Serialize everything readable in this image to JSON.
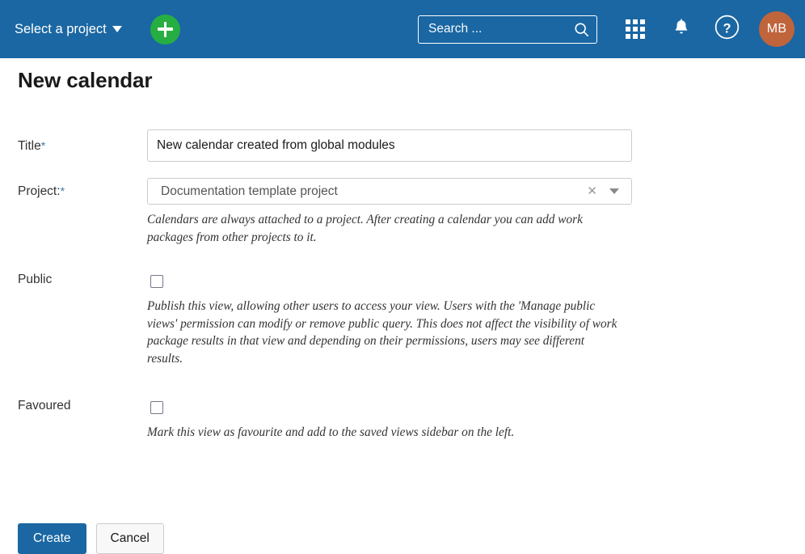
{
  "header": {
    "project_selector_label": "Select a project",
    "add_button_icon": "plus-icon",
    "search": {
      "placeholder": "Search ...",
      "value": "",
      "icon": "search-icon"
    },
    "modules_icon": "grid-icon",
    "notifications_icon": "bell-icon",
    "help_icon": "question-mark-circle-icon",
    "avatar_initials": "MB",
    "colors": {
      "bar_background": "#1A67A3",
      "add_button": "#27AE42",
      "avatar": "#C0643C"
    }
  },
  "page": {
    "title": "New calendar"
  },
  "form": {
    "title_field": {
      "label": "Title",
      "required_marker": "*",
      "value": "New calendar created from global modules",
      "placeholder": ""
    },
    "project_field": {
      "label": "Project:",
      "required_marker": "*",
      "selected_value": "Documentation template project",
      "clear_icon": "close-x-icon",
      "dropdown_icon": "chevron-down-icon",
      "help_text": "Calendars are always attached to a project. After creating a calendar you can add work packages from other projects to it."
    },
    "public_field": {
      "label": "Public",
      "checked": false,
      "help_text": "Publish this view, allowing other users to access your view. Users with the 'Manage public views' permission can modify or remove public query. This does not affect the visibility of work package results in that view and depending on their permissions, users may see different results."
    },
    "favoured_field": {
      "label": "Favoured",
      "checked": false,
      "help_text": "Mark this view as favourite and add to the saved views sidebar on the left."
    },
    "actions": {
      "create_label": "Create",
      "cancel_label": "Cancel"
    }
  }
}
